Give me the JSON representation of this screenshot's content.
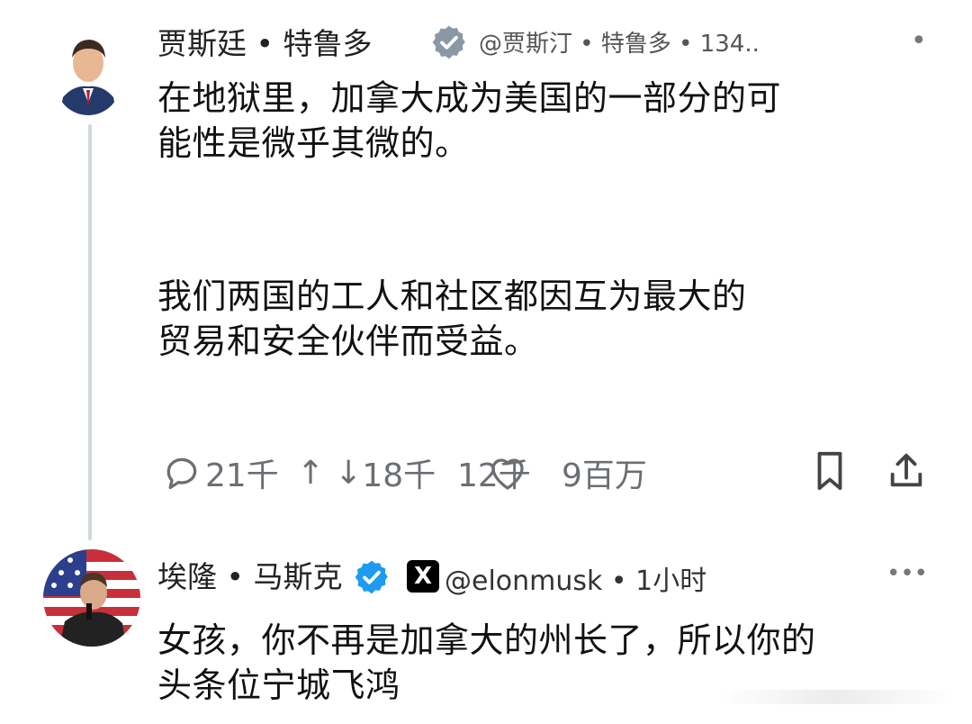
{
  "tweet1": {
    "author_name": "贾斯廷 • 特鲁多",
    "handle_meta": "@贾斯汀 • 特鲁多 • 134..",
    "more_label": "•",
    "body_line1": "在地狱里，加拿大成为美国的一部分的可",
    "body_line2": "能性是微乎其微的。",
    "body_line3": "我们两国的工人和社区都因互为最大的",
    "body_line4": "贸易和安全伙伴而受益。",
    "actions": {
      "replies": "21千",
      "retweets": "18千",
      "likes": "12千",
      "views": "9百万"
    }
  },
  "tweet2": {
    "author_name": "埃隆 • 马斯克",
    "x_badge": "X",
    "handle_meta": "@elonmusk • 1小时",
    "more_label": "•••",
    "body_line1": "女孩，你不再是加拿大的州长了，所以你的",
    "body_line2": "头条位宁城飞鸿"
  },
  "icons": [
    "reply-icon",
    "retweet-up-icon",
    "retweet-down-icon",
    "like-icon",
    "bookmark-icon",
    "share-icon",
    "verified-badge-icon",
    "x-logo-icon"
  ],
  "colors": {
    "verified_blue": "#1d9bf0",
    "verified_gray": "#8a98a5",
    "muted_text": "#6b6f73"
  }
}
